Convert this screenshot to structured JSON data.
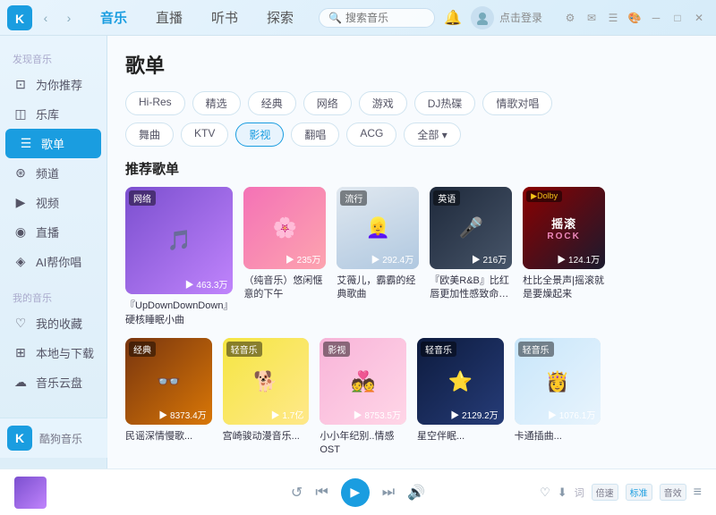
{
  "titlebar": {
    "nav_back": "‹",
    "nav_forward": "›",
    "tabs": [
      "音乐",
      "直播",
      "听书",
      "探索"
    ],
    "active_tab": "音乐",
    "search_placeholder": "搜索音乐",
    "login_text": "点击登录",
    "win_minimize": "─",
    "win_restore": "□",
    "win_close": "✕"
  },
  "sidebar": {
    "discover_section": "发现音乐",
    "items": [
      {
        "id": "recommended",
        "icon": "⊡",
        "label": "为你推荐"
      },
      {
        "id": "library",
        "icon": "◫",
        "label": "乐库"
      },
      {
        "id": "playlist",
        "icon": "☰",
        "label": "歌单",
        "active": true
      },
      {
        "id": "channel",
        "icon": "⊛",
        "label": "频道"
      },
      {
        "id": "video",
        "icon": "▶",
        "label": "视频"
      },
      {
        "id": "live",
        "icon": "◉",
        "label": "直播"
      },
      {
        "id": "ai",
        "icon": "◈",
        "label": "AI帮你唱"
      }
    ],
    "my_music_section": "我的音乐",
    "my_items": [
      {
        "id": "favorites",
        "icon": "♡",
        "label": "我的收藏"
      },
      {
        "id": "local",
        "icon": "⊞",
        "label": "本地与下载"
      },
      {
        "id": "cloud",
        "icon": "☁",
        "label": "音乐云盘"
      }
    ],
    "logo_k": "K",
    "logo_text": "酷狗音乐"
  },
  "content": {
    "page_title": "歌单",
    "filter_rows": [
      [
        {
          "label": "Hi-Res",
          "active": false
        },
        {
          "label": "精选",
          "active": false
        },
        {
          "label": "经典",
          "active": false
        },
        {
          "label": "网络",
          "active": false
        },
        {
          "label": "游戏",
          "active": false
        },
        {
          "label": "DJ热碟",
          "active": false
        },
        {
          "label": "情歌对唱",
          "active": false
        }
      ],
      [
        {
          "label": "舞曲",
          "active": false
        },
        {
          "label": "KTV",
          "active": false
        },
        {
          "label": "影视",
          "active": true
        },
        {
          "label": "翻唱",
          "active": false
        },
        {
          "label": "ACG",
          "active": false
        },
        {
          "label": "全部 ▾",
          "active": false,
          "more": true
        }
      ]
    ],
    "recommended_section": "推荐歌单",
    "playlists_row1": [
      {
        "tag": "网络",
        "grad": "grad-purple",
        "play_count": "▶ 463.3万",
        "name": "『UpDownDownDown』硬核睡眠小曲",
        "text": ""
      },
      {
        "tag": "",
        "grad": "grad-pink",
        "play_count": "▶ 235万",
        "name": "（纯音乐）悠闲惬意的下午",
        "text": ""
      },
      {
        "tag": "流行",
        "grad": "grad-blue",
        "play_count": "▶ 292.4万",
        "name": "艾薇儿，霸霸的经典歌曲",
        "text": ""
      },
      {
        "tag": "英语",
        "grad": "grad-dark",
        "play_count": "▶ 216万",
        "name": "『欧美R&B』比红唇更加性感致命的旋律",
        "text": ""
      },
      {
        "tag": "dolby",
        "grad": "grad-red",
        "play_count": "▶ 124.1万",
        "name": "杜比全景声|摇滚就是要燥起来",
        "text": "摇滚\nROCK"
      }
    ],
    "playlists_row2": [
      {
        "tag": "经典",
        "grad": "grad-brown",
        "play_count": "▶ 8373.4万",
        "name": "民谣深情慢歌...",
        "text": ""
      },
      {
        "tag": "轻音乐",
        "grad": "grad-yellow",
        "play_count": "▶ 1.7亿",
        "name": "宫崎骏动漫音乐...",
        "text": ""
      },
      {
        "tag": "影视",
        "grad": "grad-romance",
        "play_count": "▶ 8753.5万",
        "name": "小小年纪别..情感OST",
        "text": ""
      },
      {
        "tag": "轻音乐",
        "grad": "grad-night",
        "play_count": "▶ 2129.2万",
        "name": "星空伴眠...",
        "text": ""
      },
      {
        "tag": "轻音乐",
        "grad": "grad-anime",
        "play_count": "▶ 1076.1万",
        "name": "卡通插曲...",
        "text": ""
      }
    ]
  },
  "player": {
    "prev": "⟨⟨",
    "play": "▶",
    "next": "⟩⟩",
    "repeat": "↺",
    "volume": "🔊",
    "speed": "倍速",
    "quality": "标准",
    "eq": "音效",
    "lyrics_icon": "词",
    "playlist_icon": "≡"
  }
}
